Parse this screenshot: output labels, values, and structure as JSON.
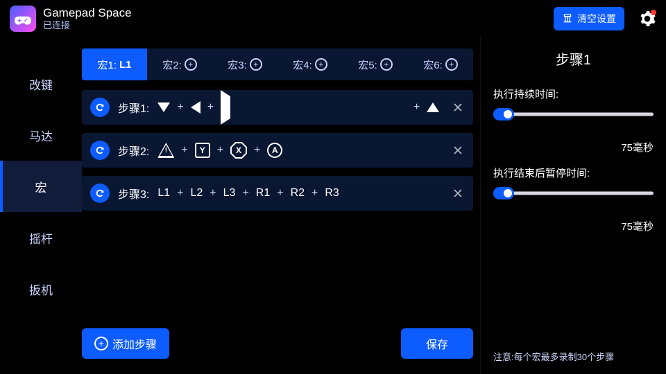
{
  "header": {
    "title": "Gamepad Space",
    "status": "已连接",
    "clear_label": "清空设置"
  },
  "sidebar": {
    "items": [
      {
        "label": "改键"
      },
      {
        "label": "马达"
      },
      {
        "label": "宏"
      },
      {
        "label": "摇杆"
      },
      {
        "label": "扳机"
      }
    ],
    "active_index": 2
  },
  "macros": {
    "tabs": [
      {
        "label": "宏1:",
        "value": "L1",
        "filled": true
      },
      {
        "label": "宏2:",
        "filled": false
      },
      {
        "label": "宏3:",
        "filled": false
      },
      {
        "label": "宏4:",
        "filled": false
      },
      {
        "label": "宏5:",
        "filled": false
      },
      {
        "label": "宏6:",
        "filled": false
      }
    ],
    "active_tab": 0,
    "steps": [
      {
        "label": "步骤1:",
        "tokens": [
          "dpad_down",
          "dpad_left",
          "dpad_right",
          "dpad_up"
        ]
      },
      {
        "label": "步骤2:",
        "tokens": [
          "btn_triangle",
          "btn_y",
          "btn_x",
          "btn_a"
        ]
      },
      {
        "label": "步骤3:",
        "tokens": [
          "L1",
          "L2",
          "L3",
          "R1",
          "R2",
          "R3"
        ]
      }
    ],
    "add_step_label": "添加步骤",
    "save_label": "保存"
  },
  "right": {
    "title": "步骤1",
    "sliders": [
      {
        "label": "执行持续时间:",
        "value": "75毫秒"
      },
      {
        "label": "执行结束后暂停时间:",
        "value": "75毫秒"
      }
    ],
    "note": "注意:每个宏最多录制30个步骤"
  }
}
